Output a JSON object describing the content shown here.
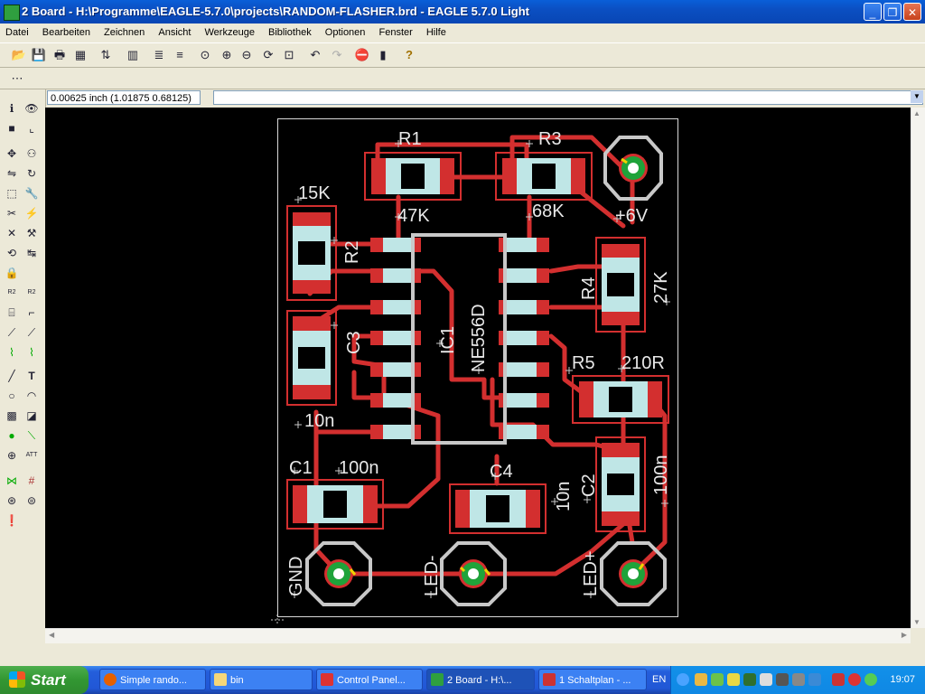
{
  "window": {
    "title": "2 Board - H:\\Programme\\EAGLE-5.7.0\\projects\\RANDOM-FLASHER.brd - EAGLE 5.7.0 Light"
  },
  "menu": [
    "Datei",
    "Bearbeiten",
    "Zeichnen",
    "Ansicht",
    "Werkzeuge",
    "Bibliothek",
    "Optionen",
    "Fenster",
    "Hilfe"
  ],
  "command_line": {
    "coordinates": "0.00625 inch (1.01875 0.68125)",
    "value": ""
  },
  "board": {
    "labels": {
      "r1": "R1",
      "r3": "R3",
      "k15": "15K",
      "k47": "47K",
      "k68": "68K",
      "v6": "+6V",
      "r2": "R2",
      "r4": "R4",
      "k27": "27K",
      "c3": "C3",
      "ic1": "IC1",
      "ne556": "NE556D",
      "r5": "R5",
      "r210": "210R",
      "n10a": "10n",
      "c1": "C1",
      "n100a": "100n",
      "c4": "C4",
      "n10b": "10n",
      "c2": "C2",
      "n100b": "100n",
      "gnd": "GND",
      "ledm": "LED-",
      "ledp": "LED+"
    },
    "colors": {
      "copper": "#d32f2f",
      "pad": "#bfe6e6",
      "outline": "#c8c8c8",
      "via_ring": "#1fa33a"
    }
  },
  "taskbar": {
    "start": "Start",
    "tasks": [
      "Simple rando...",
      "bin",
      "Control Panel...",
      "2 Board - H:\\...",
      "1 Schaltplan - ..."
    ],
    "lang": "EN",
    "clock": "19:07"
  }
}
